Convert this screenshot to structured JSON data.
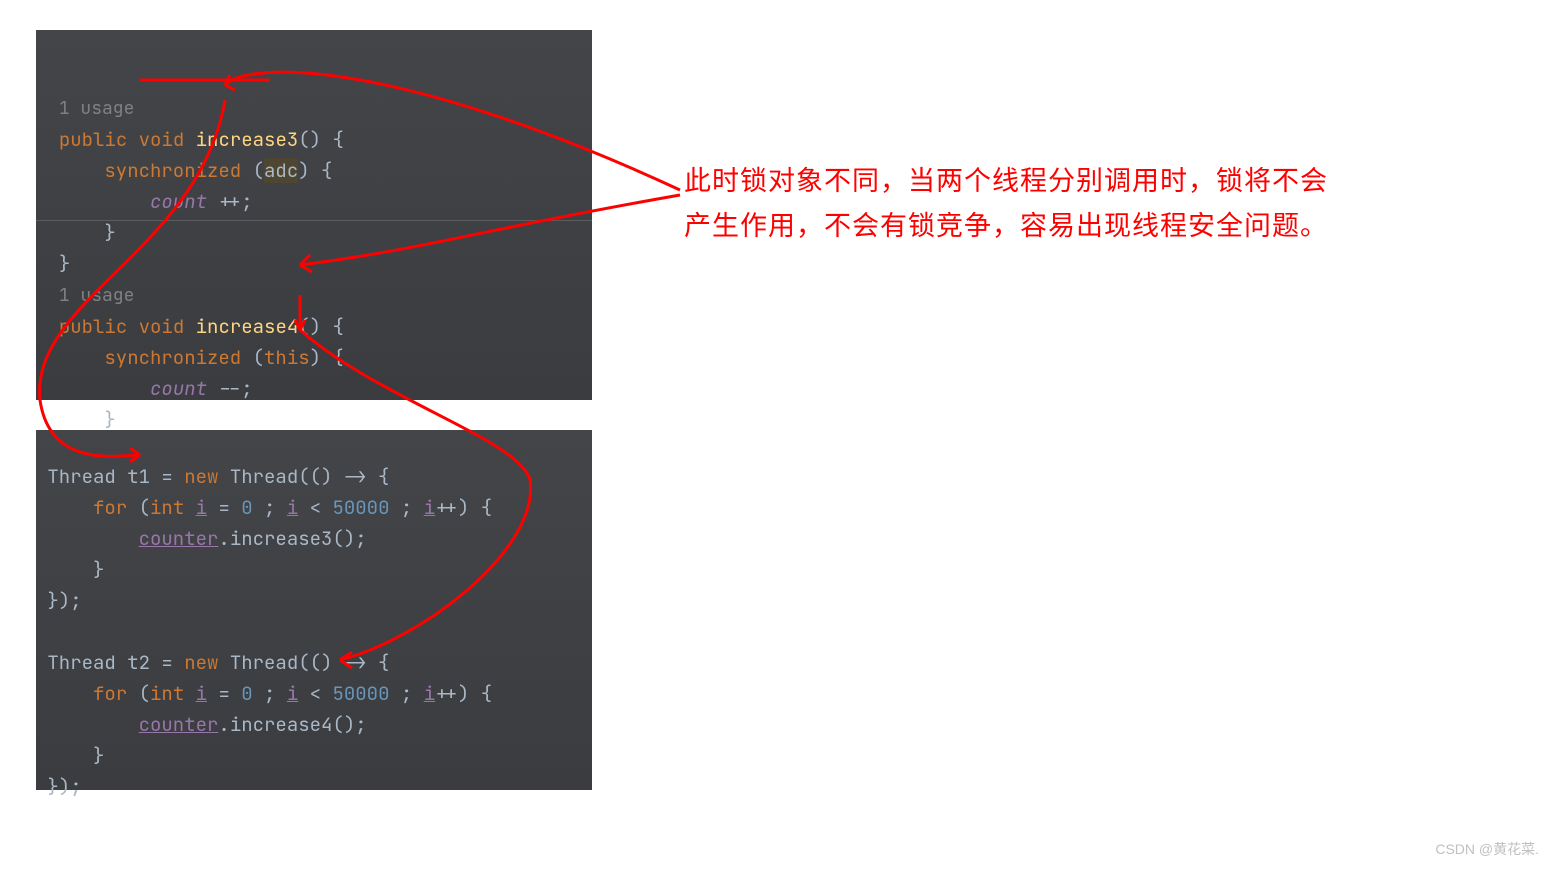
{
  "code1": {
    "hint1": "1 usage",
    "line1_kw1": "public ",
    "line1_kw2": "void ",
    "line1_name": "increase3",
    "line1_rest": "() {",
    "line2_kw": "synchronized ",
    "line2_paren1": "(",
    "line2_var": "adc",
    "line2_paren2": ") {",
    "line3_var": "count",
    "line3_op": " ++;",
    "line4": "    }",
    "line5": "}",
    "hint2": "1 usage",
    "line6_kw1": "public ",
    "line6_kw2": "void ",
    "line6_name": "increase4",
    "line6_rest": "() {",
    "line7_kw": "synchronized ",
    "line7_paren1": "(",
    "line7_this": "this",
    "line7_paren2": ") {",
    "line8_var": "count",
    "line8_op": " --;",
    "line9": "    }",
    "line10": "}"
  },
  "code2": {
    "l1a": "Thread t1 = ",
    "l1new": "new ",
    "l1b": "Thread(() -> {",
    "l2a": "    ",
    "l2for": "for ",
    "l2b": "(",
    "l2int": "int ",
    "l2i1": "i",
    "l2c": " = ",
    "l2z": "0",
    "l2d": " ; ",
    "l2i2": "i",
    "l2e": " < ",
    "l2n": "50000",
    "l2f": " ; ",
    "l2i3": "i",
    "l2g": "++) {",
    "l3a": "        ",
    "l3cnt": "counter",
    "l3b": ".increase3();",
    "l4": "    }",
    "l5": "});",
    "blank": "",
    "l6a": "Thread t2 = ",
    "l6new": "new ",
    "l6b": "Thread(() -> {",
    "l7a": "    ",
    "l7for": "for ",
    "l7b": "(",
    "l7int": "int ",
    "l7i1": "i",
    "l7c": " = ",
    "l7z": "0",
    "l7d": " ; ",
    "l7i2": "i",
    "l7e": " < ",
    "l7n": "50000",
    "l7f": " ; ",
    "l7i3": "i",
    "l7g": "++) {",
    "l8a": "        ",
    "l8cnt": "counter",
    "l8b": ".increase4();",
    "l9": "    }",
    "l10": "});"
  },
  "annotation": {
    "line1": "此时锁对象不同，当两个线程分别调用时，锁将不会",
    "line2": "产生作用，不会有锁竞争，容易出现线程安全问题。"
  },
  "watermark": "CSDN @黄花菜."
}
